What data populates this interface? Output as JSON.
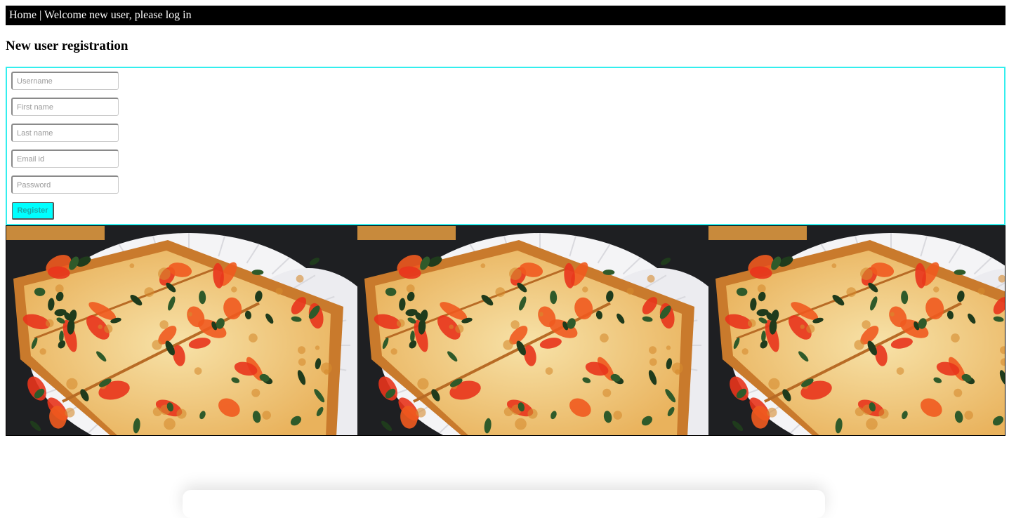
{
  "nav": {
    "home_label": "Home",
    "separator": "|",
    "welcome_text": "Welcome new user, please log in"
  },
  "page": {
    "title": "New user registration"
  },
  "form": {
    "fields": [
      {
        "name": "username",
        "placeholder": "Username",
        "value": ""
      },
      {
        "name": "first-name",
        "placeholder": "First name",
        "value": ""
      },
      {
        "name": "last-name",
        "placeholder": "Last name",
        "value": ""
      },
      {
        "name": "email",
        "placeholder": "Email id",
        "value": ""
      },
      {
        "name": "password",
        "placeholder": "Password",
        "value": ""
      }
    ],
    "register_label": "Register"
  },
  "gallery": {
    "images": [
      "pizza-image",
      "pizza-image",
      "pizza-image"
    ]
  },
  "colors": {
    "topbar_bg": "#000000",
    "form_border": "#33eeee",
    "button_bg": "#00ffff"
  }
}
